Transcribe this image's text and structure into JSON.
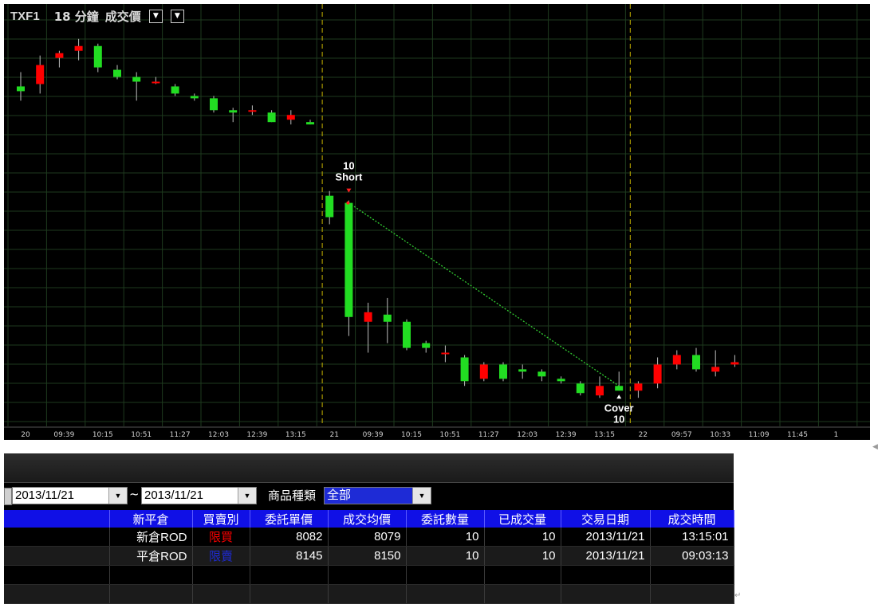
{
  "chart_header": {
    "symbol": "TXF1",
    "interval": "18 分鐘",
    "price_type": "成交價"
  },
  "chart_data": {
    "type": "candlestick",
    "x_axis_labels": [
      "20",
      "09:39",
      "10:15",
      "10:51",
      "11:27",
      "12:03",
      "12:39",
      "13:15",
      "21",
      "09:39",
      "10:15",
      "10:51",
      "11:27",
      "12:03",
      "12:39",
      "13:15",
      "22",
      "09:57",
      "10:33",
      "11:09",
      "11:45",
      "1"
    ],
    "session_dividers_after": [
      "13:15 (20)",
      "13:15 (21)"
    ],
    "candles": [
      {
        "session": "20",
        "o": 8128,
        "h": 8134,
        "l": 8122,
        "c": 8126
      },
      {
        "session": "20",
        "o": 8129,
        "h": 8141,
        "l": 8125,
        "c": 8137
      },
      {
        "session": "20",
        "o": 8140,
        "h": 8143,
        "l": 8136,
        "c": 8142
      },
      {
        "session": "20",
        "o": 8143,
        "h": 8148,
        "l": 8139,
        "c": 8145
      },
      {
        "session": "20",
        "o": 8145,
        "h": 8146,
        "l": 8134,
        "c": 8136
      },
      {
        "session": "20",
        "o": 8135,
        "h": 8137,
        "l": 8131,
        "c": 8132
      },
      {
        "session": "20",
        "o": 8132,
        "h": 8134,
        "l": 8122,
        "c": 8130
      },
      {
        "session": "20",
        "o": 8130,
        "h": 8132,
        "l": 8129,
        "c": 8130
      },
      {
        "session": "20",
        "o": 8128,
        "h": 8129,
        "l": 8124,
        "c": 8125
      },
      {
        "session": "20",
        "o": 8124,
        "h": 8125,
        "l": 8122,
        "c": 8123
      },
      {
        "session": "20",
        "o": 8123,
        "h": 8124,
        "l": 8117,
        "c": 8118
      },
      {
        "session": "20",
        "o": 8118,
        "h": 8119,
        "l": 8113,
        "c": 8117
      },
      {
        "session": "20",
        "o": 8118,
        "h": 8120,
        "l": 8116,
        "c": 8118
      },
      {
        "session": "20",
        "o": 8117,
        "h": 8118,
        "l": 8113,
        "c": 8113
      },
      {
        "session": "20",
        "o": 8114,
        "h": 8118,
        "l": 8112,
        "c": 8116
      },
      {
        "session": "20",
        "o": 8113,
        "h": 8114,
        "l": 8112,
        "c": 8112
      },
      {
        "session": "21",
        "o": 8082,
        "h": 8084,
        "l": 8070,
        "c": 8073
      },
      {
        "session": "21",
        "o": 8079,
        "h": 8080,
        "l": 8023,
        "c": 8031
      },
      {
        "session": "21",
        "o": 8029,
        "h": 8037,
        "l": 8016,
        "c": 8033
      },
      {
        "session": "21",
        "o": 8032,
        "h": 8039,
        "l": 8020,
        "c": 8029
      },
      {
        "session": "21",
        "o": 8029,
        "h": 8030,
        "l": 8017,
        "c": 8018
      },
      {
        "session": "21",
        "o": 8020,
        "h": 8021,
        "l": 8016,
        "c": 8018
      },
      {
        "session": "21",
        "o": 8016,
        "h": 8019,
        "l": 8012,
        "c": 8016
      },
      {
        "session": "21",
        "o": 8014,
        "h": 8015,
        "l": 8002,
        "c": 8004
      },
      {
        "session": "21",
        "o": 8005,
        "h": 8012,
        "l": 8004,
        "c": 8011
      },
      {
        "session": "21",
        "o": 8011,
        "h": 8012,
        "l": 8004,
        "c": 8005
      },
      {
        "session": "21",
        "o": 8009,
        "h": 8011,
        "l": 8005,
        "c": 8008
      },
      {
        "session": "21",
        "o": 8008,
        "h": 8009,
        "l": 8004,
        "c": 8006
      },
      {
        "session": "21",
        "o": 8005,
        "h": 8006,
        "l": 8003,
        "c": 8004
      },
      {
        "session": "21",
        "o": 8003,
        "h": 8004,
        "l": 7998,
        "c": 7999
      },
      {
        "session": "21",
        "o": 7998,
        "h": 8006,
        "l": 7997,
        "c": 8002
      },
      {
        "session": "21",
        "o": 8002,
        "h": 8008,
        "l": 8000,
        "c": 8000
      },
      {
        "session": "22",
        "o": 8000,
        "h": 8004,
        "l": 7997,
        "c": 8003
      },
      {
        "session": "22",
        "o": 8003,
        "h": 8014,
        "l": 8001,
        "c": 8011
      },
      {
        "session": "22",
        "o": 8011,
        "h": 8017,
        "l": 8009,
        "c": 8015
      },
      {
        "session": "22",
        "o": 8015,
        "h": 8018,
        "l": 8008,
        "c": 8009
      },
      {
        "session": "22",
        "o": 8008,
        "h": 8017,
        "l": 8006,
        "c": 8010
      },
      {
        "session": "22",
        "o": 8011,
        "h": 8015,
        "l": 8010,
        "c": 8012
      }
    ],
    "annotations": [
      {
        "text_top": "10",
        "text_bottom": "Short",
        "candle_index": 17,
        "price": 8079
      },
      {
        "text_top": "Cover",
        "text_bottom": "10",
        "candle_index": 31,
        "price": 8002
      }
    ],
    "trade_line": {
      "from_candle": 17,
      "from_price": 8079,
      "to_candle": 31,
      "to_price": 8002,
      "color": "#32cd32"
    },
    "colors": {
      "up": "#ff0000",
      "down": "#22dd22",
      "grid": "#1e3a1e",
      "divider": "#c8b400",
      "background": "#000000"
    },
    "grid": true
  },
  "filter": {
    "date_from": "2013/11/21",
    "tilde": "~",
    "date_to": "2013/11/21",
    "category_label": "商品種類",
    "category_value": "全部"
  },
  "table": {
    "headers": [
      "",
      "新平倉",
      "買賣別",
      "委託單價",
      "成交均價",
      "委託數量",
      "已成交量",
      "交易日期",
      "成交時間"
    ],
    "rows": [
      {
        "type": "新倉ROD",
        "side": "限買",
        "side_color": "#ff0000",
        "order_price": "8082",
        "avg_price": "8079",
        "order_qty": "10",
        "filled_qty": "10",
        "date": "2013/11/21",
        "time": "13:15:01"
      },
      {
        "type": "平倉ROD",
        "side": "限賣",
        "side_color": "#1e2bd6",
        "order_price": "8145",
        "avg_price": "8150",
        "order_qty": "10",
        "filled_qty": "10",
        "date": "2013/11/21",
        "time": "09:03:13"
      }
    ]
  }
}
